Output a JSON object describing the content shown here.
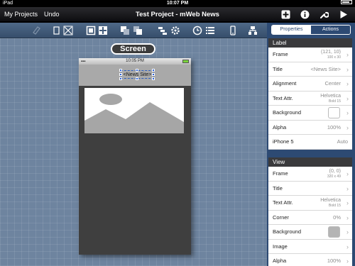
{
  "status_bar": {
    "carrier": "iPad",
    "time": "10:07 PM"
  },
  "nav": {
    "my_projects": "My Projects",
    "undo": "Undo",
    "title": "Test Project - mWeb News",
    "icons": [
      "add-icon",
      "info-icon",
      "wrench-icon",
      "play-icon"
    ]
  },
  "toolbar": {
    "icons": [
      "eraser-icon",
      "resize-icon",
      "crop-icon",
      "group-icon",
      "align-icon",
      "rotate-icon",
      "settings-icon",
      "clock-icon",
      "list-icon",
      "phone-icon",
      "hierarchy-icon"
    ]
  },
  "canvas": {
    "screen_label": "Screen",
    "device_time": "10:05 PM",
    "label_text": "<News Site>"
  },
  "panel": {
    "tabs": {
      "properties": "Properties",
      "actions": "Actions",
      "selected": "actions"
    },
    "label_section": {
      "title": "Label",
      "rows": [
        {
          "label": "Frame",
          "value": "(121, 10)",
          "sub": "100 x 30"
        },
        {
          "label": "Title",
          "value": "<News Site>"
        },
        {
          "label": "Alignment",
          "value": "Center"
        },
        {
          "label": "Text Attr.",
          "value": "Helvetica",
          "sub": "Bold 15"
        },
        {
          "label": "Background",
          "swatch": "#ffffff"
        },
        {
          "label": "Alpha",
          "value": "100%"
        },
        {
          "label": "iPhone 5",
          "value": "Auto"
        }
      ]
    },
    "view_section": {
      "title": "View",
      "rows": [
        {
          "label": "Frame",
          "value": "(0, 0)",
          "sub": "320 x 49"
        },
        {
          "label": "Title",
          "value": ""
        },
        {
          "label": "Text Attr.",
          "value": "Helvetica",
          "sub": "Bold 15"
        },
        {
          "label": "Corner",
          "value": "0%"
        },
        {
          "label": "Background",
          "swatch": "#b4b4b4"
        },
        {
          "label": "Image",
          "value": ""
        },
        {
          "label": "Alpha",
          "value": "100%"
        }
      ]
    }
  },
  "colors": {
    "nav_bg": "#1b1b1f",
    "toolbar_bg": "#445d7c",
    "canvas_bg": "#6e849f",
    "panel_bg": "#2d4a73",
    "selection": "#2a5fd6"
  }
}
